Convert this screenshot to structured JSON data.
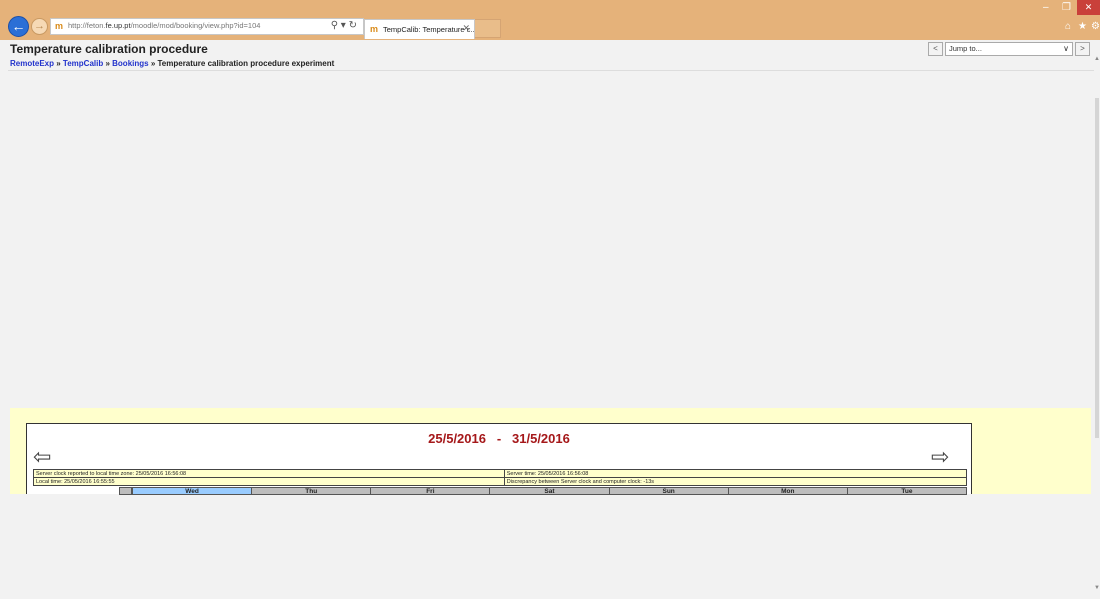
{
  "browser": {
    "url_prefix": "http://feton.",
    "url_host": "fe.up.pt",
    "url_path": "/moodle/mod/booking/view.php?id=104",
    "tab_title": "TempCalib: Temperature c...",
    "favicon_text": "m"
  },
  "page": {
    "title": "Temperature calibration procedure",
    "jump_placeholder": "Jump to...",
    "jump_prev": "<",
    "jump_next": ">"
  },
  "breadcrumb": {
    "items": [
      "RemoteExp",
      "TempCalib",
      "Bookings"
    ],
    "separator": " » ",
    "current": "Temperature calibration procedure experiment"
  },
  "booking": {
    "date_start": "25/5/2016",
    "date_sep": "-",
    "date_end": "31/5/2016",
    "server_clock_label": "Server clock reported to local time zone: 25/05/2016 16:56:08",
    "server_time_label": "Server time: 25/05/2016 16:56:08",
    "local_time_label": "Local time: 25/05/2016 16:55:55",
    "discrepancy_label": "Discrepancy between Server clock and computer clock: -13s",
    "days": [
      "Wed",
      "Thu",
      "Fri",
      "Sat",
      "Sun",
      "Mon",
      "Tue"
    ],
    "today_index": 0
  },
  "colors": {
    "chrome": "#e5b27a",
    "panel": "#ffffcc",
    "date_range": "#a5181a",
    "link": "#2233cc",
    "today": "#99ccff"
  }
}
